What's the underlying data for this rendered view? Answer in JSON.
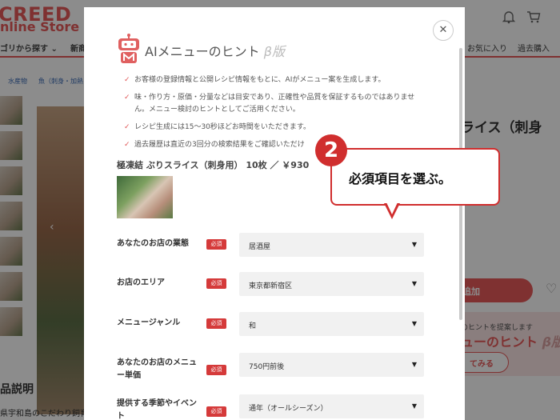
{
  "background": {
    "logo_line1": "CREED",
    "logo_line2": "nline Store",
    "nav": {
      "category": "ゴリから探す ⌄",
      "new": "新商",
      "favorites": "お気に入り",
      "history": "過去購入"
    },
    "breadcrumb": {
      "item1": "水産物",
      "item2": "魚（刺身・加熱"
    },
    "product_title_partial": "ライス（刺身",
    "cart_button": "追加",
    "hint_box": {
      "small": "のヒントを提案します",
      "big": "ューのヒント",
      "big_beta": "β版",
      "button": "てみる"
    },
    "description_title": "品説明",
    "description_text": "県宇和島のこだわり飼育"
  },
  "modal": {
    "title": "AIメニューのヒント",
    "title_beta": "β版",
    "notes": [
      "お客様の登録情報と公開レシピ情報をもとに、AIがメニュー案を生成します。",
      "味・作り方・原価・分量などは目安であり、正確性や品質を保証するものではありません。メニュー検討のヒントとしてご活用ください。",
      "レシピ生成には15〜30秒ほどお時間をいただきます。",
      "過去履歴は直近の3回分の検索結果をご確認いただけ"
    ],
    "product": "極凍結 ぶりスライス（刺身用） 10枚 ／ ￥930",
    "required_badge": "必須",
    "fields": [
      {
        "label": "あなたのお店の業態",
        "value": "居酒屋"
      },
      {
        "label": "お店のエリア",
        "value": "東京都新宿区"
      },
      {
        "label": "メニュージャンル",
        "value": "和"
      },
      {
        "label": "あなたのお店のメニュー単価",
        "value": "750円前後"
      },
      {
        "label": "提供する季節やイベント",
        "value": "通年（オールシーズン）"
      }
    ]
  },
  "callout": {
    "step": "2",
    "text": "必須項目を選ぶ。"
  },
  "colors": {
    "accent": "#e85a5a",
    "callout_red": "#d02e2e",
    "required_red": "#d53a3a"
  }
}
